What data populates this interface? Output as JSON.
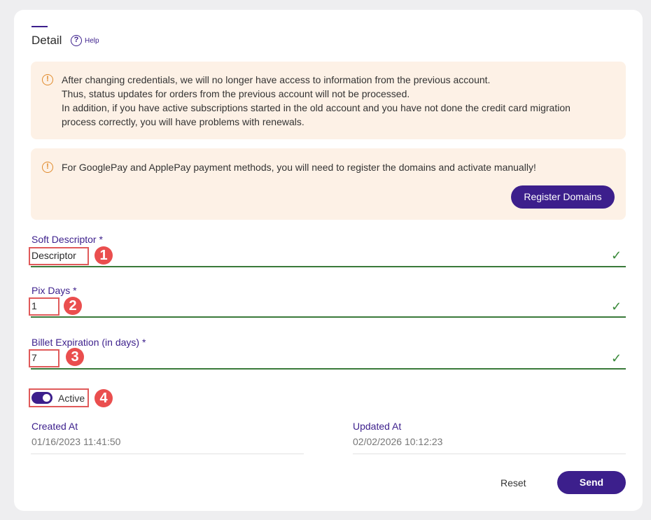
{
  "header": {
    "title": "Detail",
    "help_label": "Help"
  },
  "alerts": {
    "credentials_lines": [
      "After changing credentials, we will no longer have access to information from the previous account.",
      "Thus, status updates for orders from the previous account will not be processed.",
      "In addition, if you have active subscriptions started in the old account and you have not done the credit card migration",
      "process correctly, you will have problems with renewals."
    ],
    "payment_text": "For GooglePay and ApplePay payment methods, you will need to register the domains and activate manually!",
    "register_button": "Register Domains"
  },
  "fields": {
    "soft_descriptor": {
      "label": "Soft Descriptor *",
      "value": "Descriptor",
      "badge": "1"
    },
    "pix_days": {
      "label": "Pix Days *",
      "value": "1",
      "badge": "2"
    },
    "billet_expiration": {
      "label": "Billet Expiration (in days) *",
      "value": "7",
      "badge": "3"
    },
    "active": {
      "label": "Active",
      "badge": "4"
    }
  },
  "meta": {
    "created_label": "Created At",
    "created_value": "01/16/2023 11:41:50",
    "updated_label": "Updated At",
    "updated_value": "02/02/2026 10:12:23"
  },
  "actions": {
    "reset": "Reset",
    "send": "Send"
  },
  "colors": {
    "accent": "#3c1f8c",
    "alert_bg": "#fdf1e6",
    "warning": "#e08a2b",
    "valid": "#3a8a3a",
    "badge": "#ea4e4e"
  }
}
